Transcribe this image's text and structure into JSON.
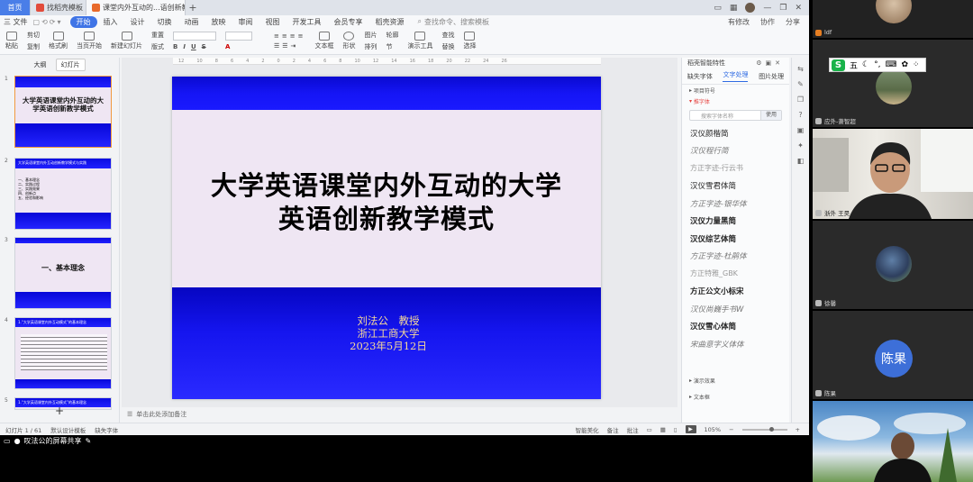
{
  "tabs": {
    "home": "首页",
    "template": "找稻壳模板",
    "doc": "课堂内外互动的...语创新教学模式"
  },
  "menu": {
    "file": "三 文件",
    "items": [
      "开始",
      "插入",
      "设计",
      "切换",
      "动画",
      "放映",
      "审阅",
      "视图",
      "开发工具",
      "会员专享",
      "稻壳资源"
    ],
    "search": "查找命令、搜索模板",
    "right": [
      "有修改",
      "协作",
      "分享"
    ]
  },
  "ribbon": {
    "paste": "粘贴",
    "cut": "剪切",
    "copy": "复制",
    "format_painter": "格式刷",
    "from_start": "当页开始",
    "new_slide": "新建幻灯片",
    "layout": "版式",
    "section": "节",
    "reset": "重置",
    "text_box": "文本框",
    "shape": "形状",
    "arrange": "排列",
    "picture": "图片",
    "outline": "轮廓",
    "find": "查找",
    "replace": "替换",
    "selection": "选择",
    "presenter": "演示工具"
  },
  "thumbs": {
    "tab_outline": "大纲",
    "tab_slides": "幻灯片",
    "slides": [
      {
        "num": "1",
        "title": "大学英语课堂内外互动的大学英语创新教学模式"
      },
      {
        "num": "2",
        "title": "大学英语课堂内外互动创新教学模式与实践",
        "items": [
          "一、基本理念",
          "二、实践过程",
          "三、实践效果",
          "四、创新点",
          "五、经验和影响"
        ]
      },
      {
        "num": "3",
        "title": "一、基本理念"
      },
      {
        "num": "4",
        "title": "1.“大学英语课堂内外互动模式”的基本理念"
      },
      {
        "num": "5",
        "title": "1.“大学英语课堂内外互动模式”的基本理念"
      }
    ]
  },
  "slide": {
    "title_line1": "大学英语课堂内外互动的大学",
    "title_line2": "英语创新教学模式",
    "author": "刘法公　教授",
    "org": "浙江工商大学",
    "date": "2023年5月12日"
  },
  "notes": "单击此处添加备注",
  "right_panel": {
    "head": "稻壳智能特性",
    "tabs": [
      "缺失字体",
      "文字处理",
      "图片处理"
    ],
    "section1": "项目符号",
    "section2": "推字体",
    "search_placeholder": "搜索字体名称",
    "search_btn": "使用",
    "fonts": [
      "汉仪颜楷简",
      "汉仪程行简",
      "方正字迹-行云书",
      "汉仪雪君体简",
      "方正字迹-银华体",
      "汉仪力量黑简",
      "汉仪综艺体简",
      "方正字迹-杜鹃体",
      "方正特雅_GBK",
      "方正公文小标宋",
      "汉仪尚巍手书W",
      "汉仪雪心体简",
      "宋曲意字义体体"
    ],
    "section3": "演示效果",
    "section4": "文本框"
  },
  "status": {
    "slide_count": "幻灯片 1 / 61",
    "design": "默认设计模板",
    "missing": "缺失字体",
    "smart": "智能美化",
    "notes": "备注",
    "comment": "批注",
    "zoom": "105%"
  },
  "share": "叹法公的屏幕共享",
  "ime": {
    "logo": "S",
    "label": "五"
  },
  "participants": [
    {
      "name": "ldf"
    },
    {
      "name": "应外-萧智超"
    },
    {
      "name": "浙外 王昊"
    },
    {
      "name": "徐馨"
    },
    {
      "name": "陈果",
      "avatar_text": "陈果"
    },
    {
      "name": ""
    }
  ],
  "colors": {
    "accent": "#3f74e6",
    "slide_band": "#1515f5",
    "slide_bg": "#efe6f3",
    "subtitle": "#f5d89a"
  }
}
